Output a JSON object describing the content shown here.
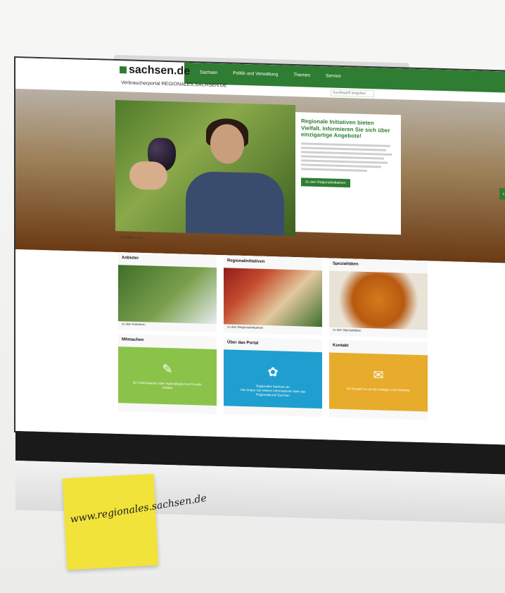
{
  "header": {
    "logo_text": "sachsen.de",
    "portal_title": "Verbraucherportal REGIONALES.SACHSEN.DE",
    "nav": [
      "Sachsen",
      "Politik und Verwaltung",
      "Themen",
      "Service"
    ],
    "search_placeholder": "Suchbegriff eingeben"
  },
  "hero": {
    "title": "Regionale Initiativen bieten Vielfalt. Informieren Sie sich über einzigartige Angebote!",
    "cta_label": "Zu den Regionalinitiativen",
    "pager_label": "Anhalten"
  },
  "tiles": [
    {
      "title": "Anbieter",
      "link": "zu den Anbietern"
    },
    {
      "title": "Regionalinitiativen",
      "link": "zu den Regionalinitiativen"
    },
    {
      "title": "Spezialitäten",
      "link": "zu den Spezialitäten"
    },
    {
      "title": "Mitmachen",
      "caption": "Ein interessantes oder regionaltypisches Produkt melden"
    },
    {
      "title": "Über das Portal",
      "caption": "Regionales Sachsen.de",
      "caption2": "Hier finden Sie weitere Informationen über das Regionalportal Sachsen"
    },
    {
      "title": "Kontakt",
      "caption": "Ihr Kontakt zu uns für Anliegen und Hinweise"
    }
  ],
  "sticky_note": {
    "text": "www.regionales.sachsen.de"
  },
  "colors": {
    "brand_green": "#2e7d32",
    "card_green": "#8bc34a",
    "card_blue": "#1e9fcf",
    "card_yellow": "#e7ac2c",
    "note_yellow": "#f1e33a"
  }
}
